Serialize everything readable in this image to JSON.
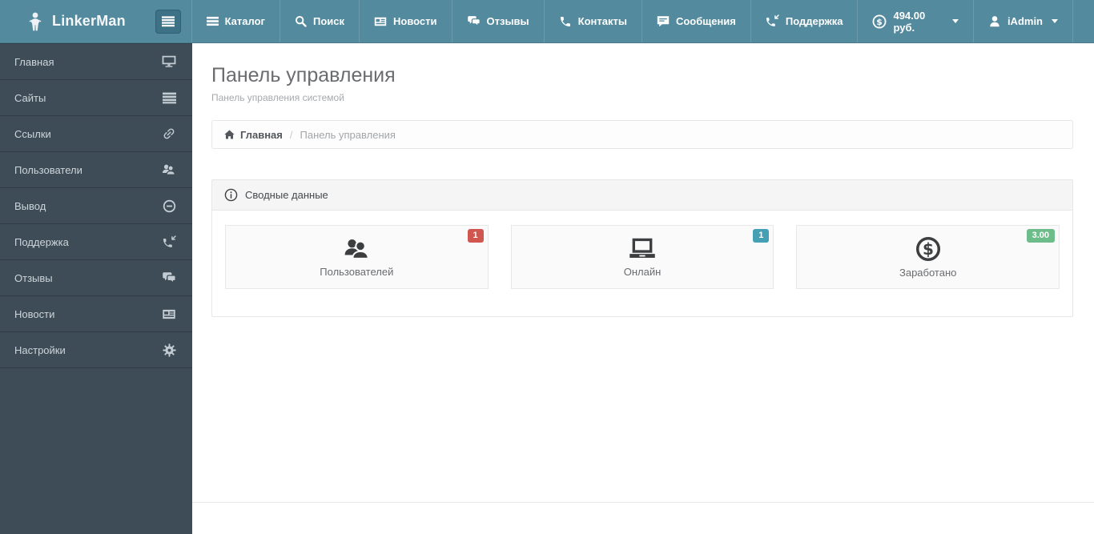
{
  "colors": {
    "navbar_bg": "#548a9e",
    "navbar_toggle_bg": "#3d7186",
    "sidebar_bg": "#3e4c57",
    "badge_danger": "#d0574f",
    "badge_info": "#45a0b5",
    "badge_success": "#6dbd8a",
    "panel_border": "#e7e7e7",
    "card_bg": "#fafafa"
  },
  "navbar": {
    "brand": "LinkerMan",
    "brand_icon": "person-figure-icon",
    "toggle_icon": "hamburger-icon",
    "items": [
      {
        "label": "Каталог",
        "icon": "bars-icon"
      },
      {
        "label": "Поиск",
        "icon": "search-icon"
      },
      {
        "label": "Новости",
        "icon": "newspaper-icon"
      },
      {
        "label": "Отзывы",
        "icon": "comments-icon"
      },
      {
        "label": "Контакты",
        "icon": "phone-icon"
      },
      {
        "label": "Сообщения",
        "icon": "message-icon"
      },
      {
        "label": "Поддержка",
        "icon": "phone-incoming-icon"
      }
    ],
    "balance": {
      "value": "494.00 руб.",
      "icon": "dollar-circle-icon",
      "caret": "caret-down-icon"
    },
    "user": {
      "name": "iAdmin",
      "icon": "user-icon",
      "caret": "caret-down-icon"
    }
  },
  "sidebar": {
    "items": [
      {
        "label": "Главная",
        "icon": "monitor-icon"
      },
      {
        "label": "Сайты",
        "icon": "menu-lines-icon"
      },
      {
        "label": "Ссылки",
        "icon": "link-icon"
      },
      {
        "label": "Пользователи",
        "icon": "users-icon"
      },
      {
        "label": "Вывод",
        "icon": "minus-circle-icon"
      },
      {
        "label": "Поддержка",
        "icon": "phone-incoming-icon"
      },
      {
        "label": "Отзывы",
        "icon": "comments-icon"
      },
      {
        "label": "Новости",
        "icon": "newspaper-icon"
      },
      {
        "label": "Настройки",
        "icon": "gear-icon"
      }
    ]
  },
  "main": {
    "title": "Панель управления",
    "subtitle": "Панель управления системой",
    "breadcrumb": {
      "home_icon": "home-icon",
      "home": "Главная",
      "separator": "/",
      "current": "Панель управления"
    },
    "panel": {
      "title_icon": "info-circle-icon",
      "title": "Сводные данные",
      "cards": [
        {
          "label": "Пользователей",
          "badge": "1",
          "badge_color": "#d0574f",
          "icon": "users-icon"
        },
        {
          "label": "Онлайн",
          "badge": "1",
          "badge_color": "#45a0b5",
          "icon": "laptop-icon"
        },
        {
          "label": "Заработано",
          "badge": "3.00",
          "badge_color": "#6dbd8a",
          "icon": "dollar-circle-icon"
        }
      ]
    }
  }
}
